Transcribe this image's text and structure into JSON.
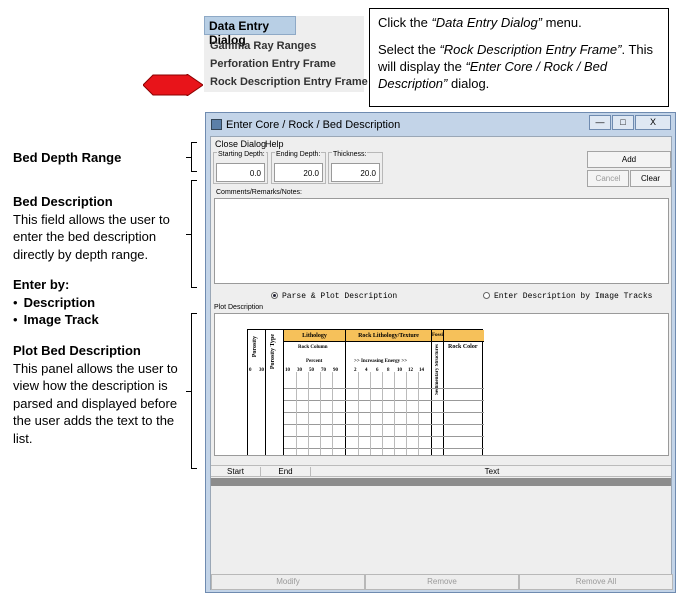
{
  "menu_snippet": {
    "title": "Data Entry Dialog",
    "items": [
      "Gamma Ray Ranges",
      "Perforation Entry Frame",
      "Rock Description Entry Frame"
    ]
  },
  "callout": {
    "line1_prefix": "Click the ",
    "line1_menu": "“Data Entry Dialog”",
    "line1_suffix": " menu.",
    "line2_prefix": "Select the ",
    "line2_item": "“Rock Description Entry Frame”",
    "line2_mid": ". This will display the ",
    "line2_dialog": "“Enter Core / Rock / Bed Description”",
    "line2_suffix": " dialog."
  },
  "notes": {
    "bed_depth_title": "Bed Depth Range",
    "bed_desc_title": "Bed Description",
    "bed_desc_text": "This field allows the user to enter the bed description directly by depth range.",
    "enter_by_title": "Enter by:",
    "enter_by_items": [
      "Description",
      "Image Track"
    ],
    "plot_title": "Plot Bed Description",
    "plot_text": "This panel allows the user to view how the description is parsed and displayed before the user adds the text to the list."
  },
  "window": {
    "title": "Enter Core / Rock / Bed Description",
    "controls": [
      "—",
      "□",
      "X"
    ],
    "menu": [
      "Close Dialog",
      "Help"
    ],
    "starting_depth_label": "Starting Depth:",
    "starting_depth_value": "0.0",
    "ending_depth_label": "Ending Depth:",
    "ending_depth_value": "20.0",
    "thickness_label": "Thickness:",
    "thickness_value": "20.0",
    "add_label": "Add",
    "cancel_label": "Cancel",
    "clear_label": "Clear",
    "comments_label": "Comments/Remarks/Notes:",
    "radio_parse": "Parse & Plot Description",
    "radio_image": "Enter Description by Image Tracks",
    "plot_label": "Plot Description",
    "track": {
      "porosity": "Porosity",
      "porosity_type": "Porosity Type",
      "lithology": "Lithology",
      "rock_column": "Rock Column",
      "percent": "Percent",
      "rock_lith_texture": "Rock Lithology/Texture",
      "increasing_energy": ">> Increasing Energy >>",
      "energy_ticks": [
        "2",
        "4",
        "6",
        "8",
        "10",
        "12",
        "14"
      ],
      "sed_struct": "Sedimentary Structures",
      "fossils": "Fossils",
      "rock_color": "Rock Color",
      "porosity_ticks": [
        "0",
        "30"
      ],
      "percent_ticks": [
        "10",
        "30",
        "50",
        "70",
        "90"
      ]
    },
    "table_headers": [
      "Start",
      "End",
      "Text"
    ],
    "modify_label": "Modify",
    "remove_label": "Remove",
    "remove_all_label": "Remove All"
  },
  "colors": {
    "window_frame": "#c3d4e8",
    "track_header": "#f6c15a",
    "menu_highlight": "#b8cfe5",
    "arrow": "#e8141a"
  }
}
